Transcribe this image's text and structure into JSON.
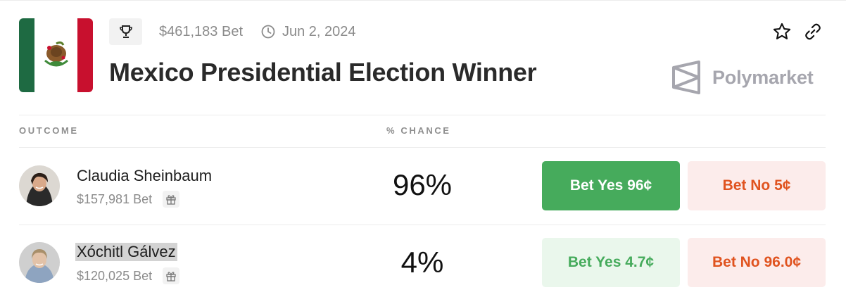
{
  "market": {
    "volume": "$461,183 Bet",
    "date": "Jun 2, 2024",
    "title": "Mexico Presidential Election Winner",
    "brand": "Polymarket"
  },
  "table": {
    "headers": {
      "outcome": "OUTCOME",
      "chance": "% CHANCE"
    },
    "rows": [
      {
        "name": "Claudia Sheinbaum",
        "bet": "$157,981 Bet",
        "chance": "96%",
        "yes_label": "Bet Yes 96¢",
        "no_label": "Bet No 5¢"
      },
      {
        "name": "Xóchitl Gálvez",
        "bet": "$120,025 Bet",
        "chance": "4%",
        "yes_label": "Bet Yes 4.7¢",
        "no_label": "Bet No 96.0¢"
      }
    ]
  },
  "icons": {
    "trophy": "trophy-icon",
    "clock": "clock-icon",
    "star": "star-icon",
    "link": "link-icon",
    "gift": "gift-icon",
    "brand_logo": "polymarket-logo-icon"
  },
  "colors": {
    "yes_green": "#46ab5c",
    "no_orange": "#e0531f",
    "flag_green": "#1e6a42",
    "flag_red": "#c8102e"
  }
}
